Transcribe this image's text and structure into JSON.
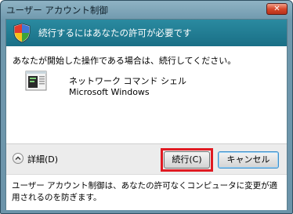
{
  "window": {
    "title": "ユーザー アカウント制御",
    "close_label": "✕"
  },
  "banner": {
    "text": "続行するにはあなたの許可が必要です"
  },
  "prompt": "あなたが開始した操作である場合は、続行してください。",
  "program": {
    "name": "ネットワーク コマンド シェル",
    "publisher": "Microsoft Windows"
  },
  "buttons": {
    "details": "詳細(D)",
    "continue": "続行(C)",
    "cancel": "キャンセル"
  },
  "footer": {
    "text": "ユーザー アカウント制御は、あなたの許可なくコンピュータに変更が適用されるのを防ぎます。"
  },
  "colors": {
    "banner": "#1a7a90",
    "highlight": "#e01a22"
  },
  "icons": [
    "shield-icon",
    "program-icon",
    "chevron-down-icon",
    "close-icon"
  ]
}
